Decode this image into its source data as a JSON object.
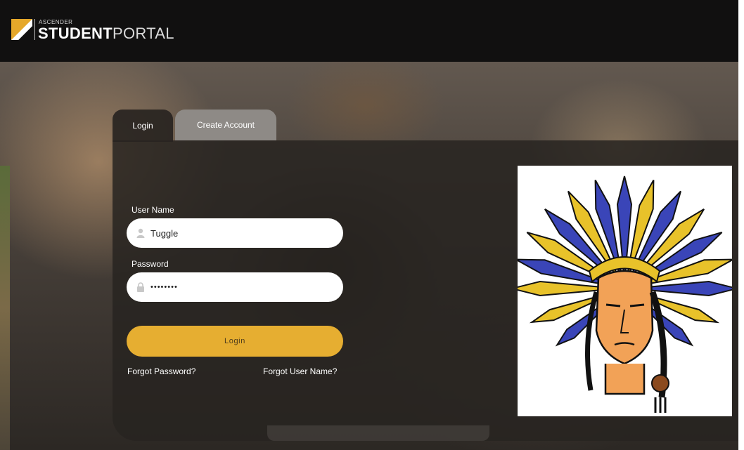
{
  "header": {
    "brand_small": "ASCENDER",
    "brand_bold": "STUDENT",
    "brand_light": "PORTAL"
  },
  "tabs": [
    {
      "label": "Login",
      "active": true
    },
    {
      "label": "Create Account",
      "active": false
    }
  ],
  "form": {
    "username_label": "User Name",
    "username_value": "Tuggle",
    "password_label": "Password",
    "password_mask": "••••••••",
    "login_label": "Login",
    "forgot_password": "Forgot Password?",
    "forgot_username": "Forgot User Name?"
  },
  "icons": {
    "username": "user-icon",
    "password": "lock-icon",
    "logo": "ascender-logo-icon",
    "mascot": "chief-headdress-mascot"
  },
  "colors": {
    "accent": "#e6ae31",
    "header_bg": "#111010",
    "panel_bg": "#28241f",
    "inactive_tab": "#8e8a86",
    "mascot_blue": "#3a45b8",
    "mascot_gold": "#e8c22a"
  }
}
